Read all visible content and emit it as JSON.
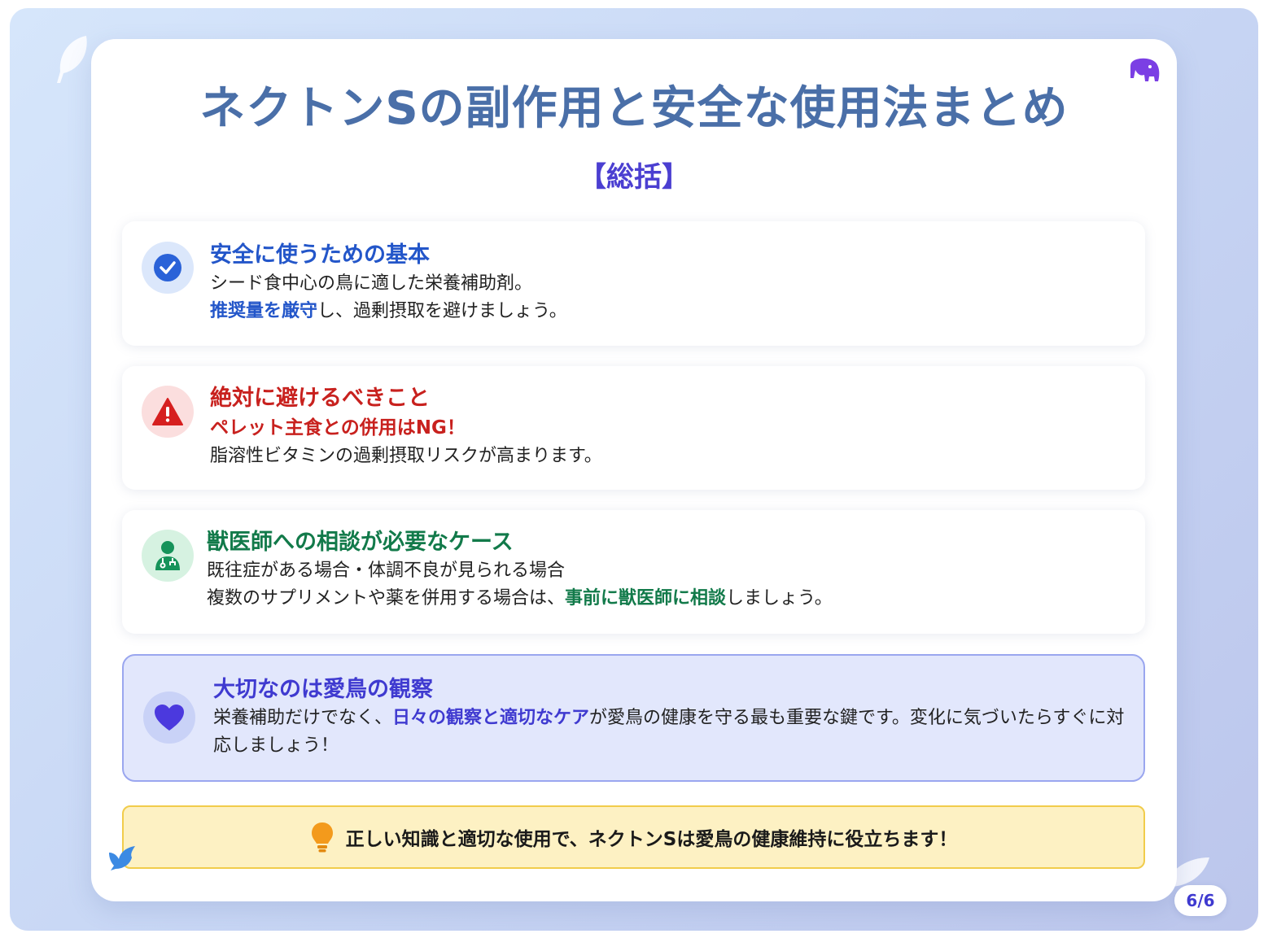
{
  "title": "ネクトンSの副作用と安全な使用法まとめ",
  "subtitle": "【総括】",
  "sections": {
    "basic": {
      "icon": "check-circle-icon",
      "heading": "安全に使うための基本",
      "line1": "シード食中心の鳥に適した栄養補助剤。",
      "line2_strong": "推奨量を厳守",
      "line2_rest": "し、過剰摂取を避けましょう。"
    },
    "avoid": {
      "icon": "warning-triangle-icon",
      "heading": "絶対に避けるべきこと",
      "alert": "ペレット主食との併用はNG！",
      "line": "脂溶性ビタミンの過剰摂取リスクが高まります。"
    },
    "vet": {
      "icon": "doctor-icon",
      "heading": "獣医師への相談が必要なケース",
      "line1": "既往症がある場合・体調不良が見られる場合",
      "line2_pre": "複数のサプリメントや薬を併用する場合は、",
      "line2_strong": "事前に獣医師に相談",
      "line2_post": "しましょう。"
    },
    "watch": {
      "icon": "heart-icon",
      "heading": "大切なのは愛鳥の観察",
      "line_pre": "栄養補助だけでなく、",
      "line_strong": "日々の観察と適切なケア",
      "line_post": "が愛鳥の健康を守る最も重要な鍵です。変化に気づいたらすぐに対応しましょう！"
    }
  },
  "tip": {
    "icon": "lightbulb-icon",
    "text": "正しい知識と適切な使用で、ネクトンSは愛鳥の健康維持に役立ちます！"
  },
  "page_indicator": "6/6",
  "colors": {
    "title": "#4a6fa8",
    "accent_purple": "#3f3ad0",
    "blue": "#2356c9",
    "red": "#c8211e",
    "green": "#127a4a",
    "tip_bg": "#fdf1c3"
  }
}
